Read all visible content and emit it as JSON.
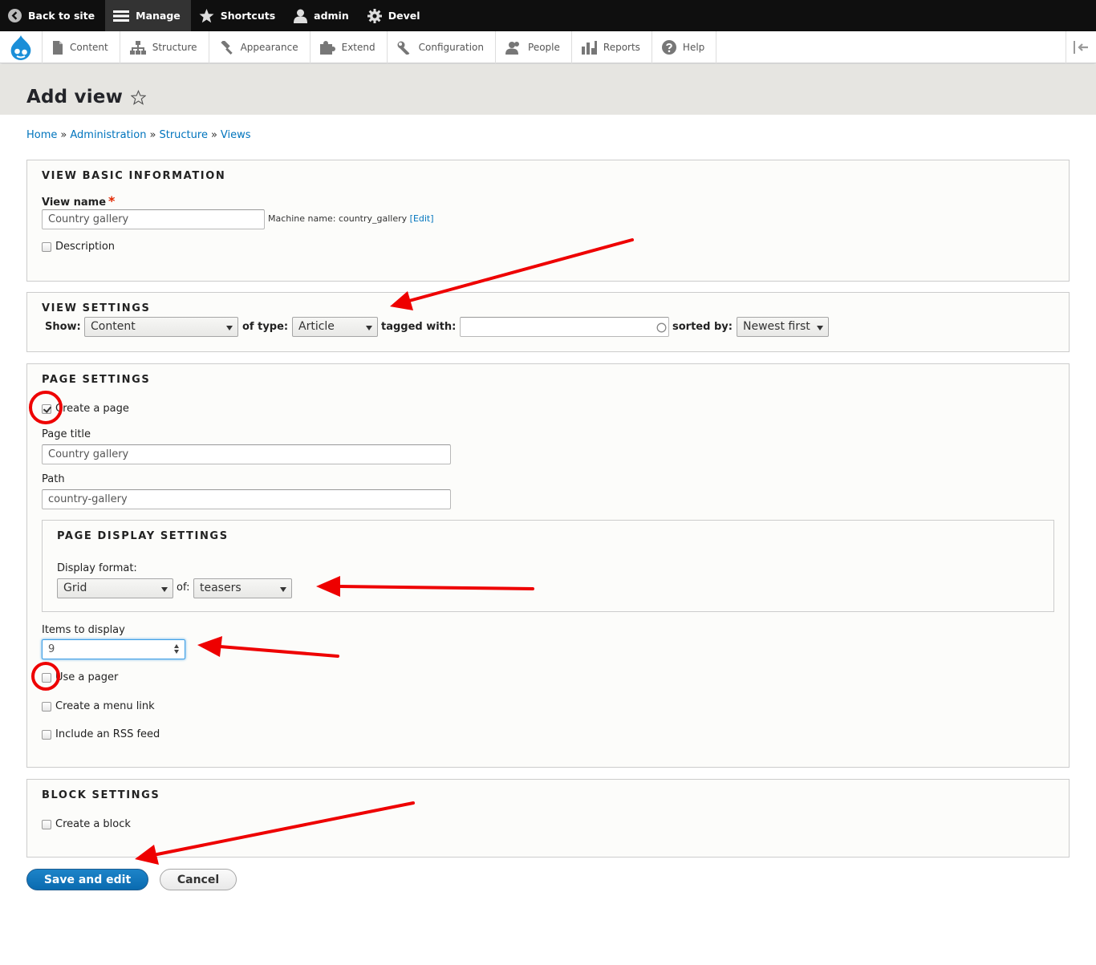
{
  "toolbar": {
    "back_label": "Back to site",
    "manage_label": "Manage",
    "shortcuts_label": "Shortcuts",
    "user_label": "admin",
    "devel_label": "Devel"
  },
  "tray": {
    "items": [
      "Content",
      "Structure",
      "Appearance",
      "Extend",
      "Configuration",
      "People",
      "Reports",
      "Help"
    ]
  },
  "page": {
    "title": "Add view"
  },
  "breadcrumb": [
    "Home",
    "Administration",
    "Structure",
    "Views"
  ],
  "breadcrumb_sep": "»",
  "basic": {
    "legend": "View basic information",
    "name_label": "View name",
    "required_mark": "*",
    "name_value": "Country gallery",
    "machine_name_text": "Machine name: country_gallery",
    "edit_link": "[Edit]",
    "description_label": "Description"
  },
  "view_settings": {
    "legend": "View settings",
    "show_label": "Show:",
    "show_value": "Content",
    "type_label": "of type:",
    "type_value": "Article",
    "tagged_label": "tagged with:",
    "tagged_value": "",
    "sorted_label": "sorted by:",
    "sorted_value": "Newest first"
  },
  "page_settings": {
    "legend": "Page settings",
    "create_page_label": "Create a page",
    "create_page_checked": true,
    "title_label": "Page title",
    "title_value": "Country gallery",
    "path_label": "Path",
    "path_value": "country-gallery",
    "display": {
      "legend": "Page display settings",
      "format_label": "Display format:",
      "format_value": "Grid",
      "of_label": "of:",
      "of_value": "teasers"
    },
    "items_label": "Items to display",
    "items_value": "9",
    "pager_label": "Use a pager",
    "menu_label": "Create a menu link",
    "rss_label": "Include an RSS feed"
  },
  "block_settings": {
    "legend": "Block settings",
    "create_block_label": "Create a block"
  },
  "actions": {
    "save_label": "Save and edit",
    "cancel_label": "Cancel"
  },
  "colors": {
    "link": "#0074bd",
    "primary": "#0a6bb0",
    "annotation": "#ee0000",
    "toolbar": "#0f0f0f"
  }
}
